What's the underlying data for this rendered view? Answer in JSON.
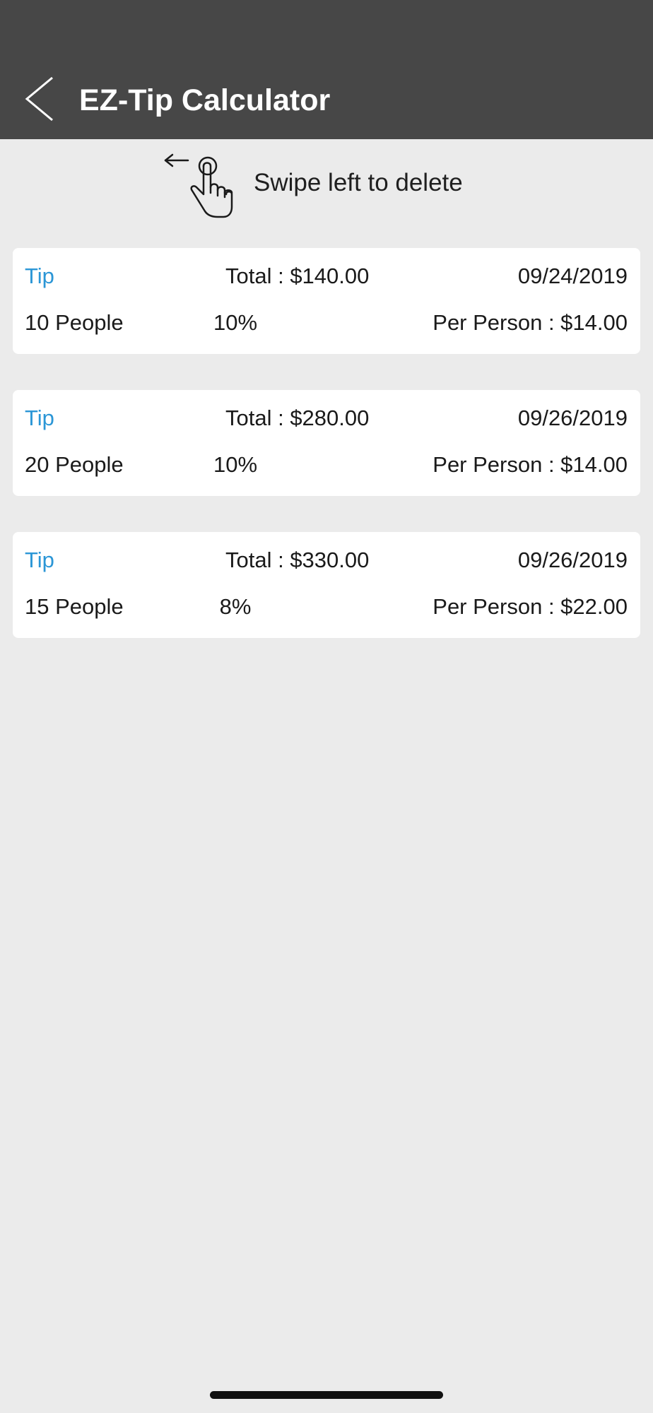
{
  "header": {
    "title": "EZ-Tip Calculator",
    "back_icon": "chevron-left-icon",
    "background": "#474747"
  },
  "hint": {
    "icon": "swipe-left-hand-icon",
    "text": "Swipe left to delete"
  },
  "history": [
    {
      "label": "Tip",
      "total": "Total : $140.00",
      "date": "09/24/2019",
      "people": "10 People",
      "percent": "10%",
      "per_person": "Per Person : $14.00"
    },
    {
      "label": "Tip",
      "total": "Total : $280.00",
      "date": "09/26/2019",
      "people": "20 People",
      "percent": "10%",
      "per_person": "Per Person : $14.00"
    },
    {
      "label": "Tip",
      "total": "Total : $330.00",
      "date": "09/26/2019",
      "people": "15 People",
      "percent": "8%",
      "per_person": "Per Person : $22.00"
    }
  ],
  "colors": {
    "accent": "#2b96d6",
    "background": "#ebebeb",
    "card": "#ffffff"
  }
}
